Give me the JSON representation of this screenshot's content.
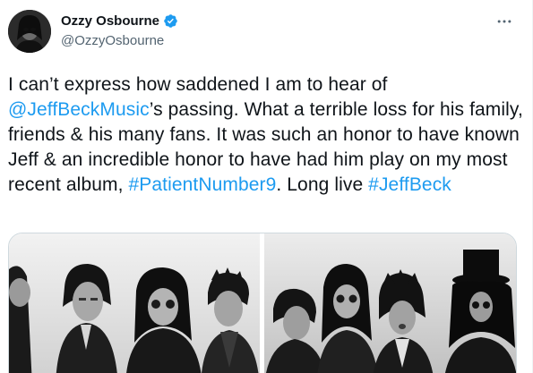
{
  "tweet": {
    "author": {
      "display_name": "Ozzy Osbourne",
      "handle": "@OzzyOsbourne",
      "verified": true,
      "avatar_icon": "avatar-photo"
    },
    "text": {
      "part1": "I can’t express how saddened I am to hear of ",
      "mention": "@JeffBeckMusic",
      "part2": "’s passing.  What a terrible loss for his family, friends & his many fans. It was such an honor to have known Jeff & an incredible honor to have had him play on my most recent album, ",
      "hashtag1": "#PatientNumber9",
      "part3": ". Long live ",
      "hashtag2": "#JeffBeck"
    },
    "media": {
      "photo_count": 2
    },
    "colors": {
      "link": "#1d9bf0",
      "verified": "#1d9bf0",
      "secondary_text": "#536471"
    }
  }
}
